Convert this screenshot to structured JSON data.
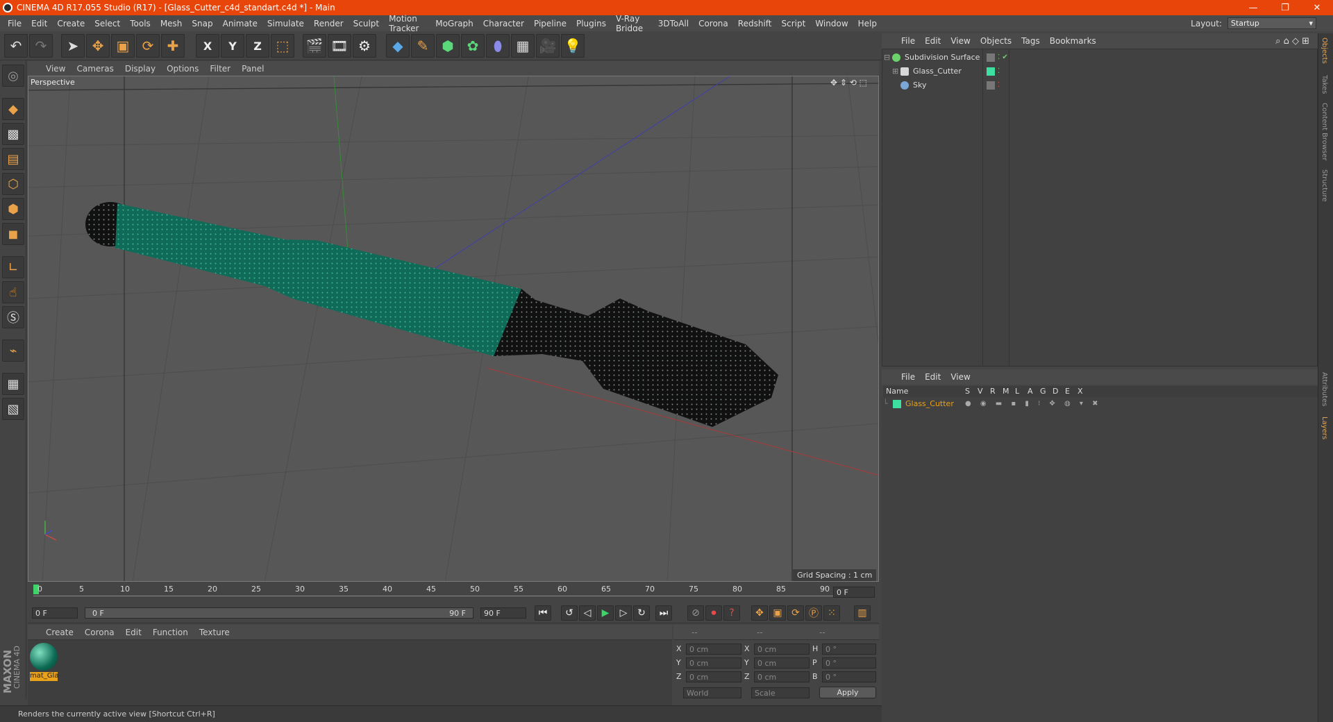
{
  "window": {
    "title": "CINEMA 4D R17.055 Studio (R17) - [Glass_Cutter_c4d_standart.c4d *] - Main",
    "controls": [
      "—",
      "❐",
      "✕"
    ]
  },
  "menubar": [
    "File",
    "Edit",
    "Create",
    "Select",
    "Tools",
    "Mesh",
    "Snap",
    "Animate",
    "Simulate",
    "Render",
    "Sculpt",
    "Motion Tracker",
    "MoGraph",
    "Character",
    "Pipeline",
    "Plugins",
    "V-Ray Bridge",
    "3DToAll",
    "Corona",
    "Redshift",
    "Script",
    "Window",
    "Help"
  ],
  "layout": {
    "label": "Layout:",
    "value": "Startup"
  },
  "toolbar": {
    "axes": [
      "X",
      "Y",
      "Z"
    ]
  },
  "viewport": {
    "menu": [
      "View",
      "Cameras",
      "Display",
      "Options",
      "Filter",
      "Panel"
    ],
    "label": "Perspective",
    "grid_spacing": "Grid Spacing : 1 cm"
  },
  "timeline": {
    "ticks": [
      "0",
      "5",
      "10",
      "15",
      "20",
      "25",
      "30",
      "35",
      "40",
      "45",
      "50",
      "55",
      "60",
      "65",
      "70",
      "75",
      "80",
      "85",
      "90"
    ],
    "current_frame": "0 F",
    "start": "0 F",
    "range_start": "0 F",
    "range_end": "90 F",
    "end": "90 F"
  },
  "material_manager": {
    "menu": [
      "Create",
      "Corona",
      "Edit",
      "Function",
      "Texture"
    ],
    "material_name": "mat_Gla"
  },
  "coordinates": {
    "headers": [
      "--",
      "--",
      "--"
    ],
    "rows": [
      {
        "l1": "X",
        "v1": "0 cm",
        "l2": "X",
        "v2": "0 cm",
        "l3": "H",
        "v3": "0 °"
      },
      {
        "l1": "Y",
        "v1": "0 cm",
        "l2": "Y",
        "v2": "0 cm",
        "l3": "P",
        "v3": "0 °"
      },
      {
        "l1": "Z",
        "v1": "0 cm",
        "l2": "Z",
        "v2": "0 cm",
        "l3": "B",
        "v3": "0 °"
      }
    ],
    "mode": "World",
    "scale": "Scale",
    "apply": "Apply"
  },
  "status": "Renders the currently active view [Shortcut Ctrl+R]",
  "maxon": {
    "a": "MAXON",
    "b": "CINEMA 4D"
  },
  "object_manager": {
    "menu": [
      "File",
      "Edit",
      "View",
      "Objects",
      "Tags",
      "Bookmarks"
    ],
    "objects": [
      {
        "name": "Subdivision Surface",
        "color": "#6bd36b"
      },
      {
        "name": "Glass_Cutter",
        "color": "#d8d8d8"
      },
      {
        "name": "Sky",
        "color": "#7aa7d8"
      }
    ]
  },
  "layer_manager": {
    "menu": [
      "File",
      "Edit",
      "View"
    ],
    "columns": [
      "Name",
      "S",
      "V",
      "R",
      "M",
      "L",
      "A",
      "G",
      "D",
      "E",
      "X"
    ],
    "layer": {
      "name": "Glass_Cutter",
      "color": "#3de0a0"
    }
  },
  "right_tabs": [
    "Objects",
    "Takes",
    "Content Browser",
    "Structure",
    "Attributes",
    "Layers"
  ]
}
